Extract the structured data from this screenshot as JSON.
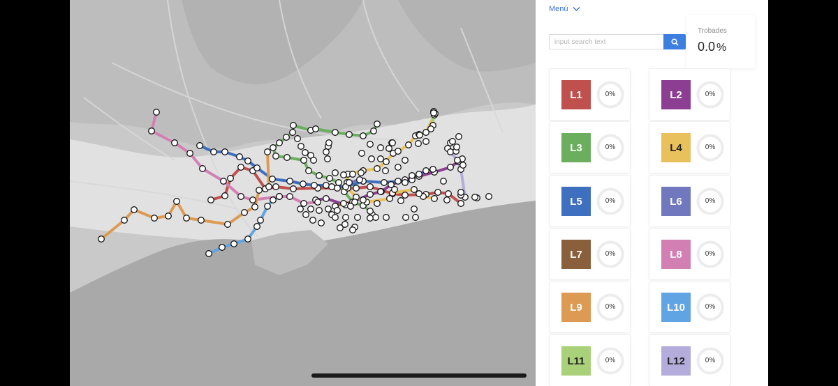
{
  "menu": {
    "label": "Menú"
  },
  "search": {
    "placeholder": "input search text"
  },
  "stats": {
    "label": "Trobades",
    "value": "0.0",
    "unit": "%"
  },
  "lines": [
    {
      "code": "L1",
      "percent": "0%",
      "color": "#c0504d",
      "text_color": "#ffffff"
    },
    {
      "code": "L2",
      "percent": "0%",
      "color": "#8c3f92",
      "text_color": "#ffffff"
    },
    {
      "code": "L3",
      "percent": "0%",
      "color": "#6aae5e",
      "text_color": "#ffffff"
    },
    {
      "code": "L4",
      "percent": "0%",
      "color": "#e9c15c",
      "text_color": "#222222"
    },
    {
      "code": "L5",
      "percent": "0%",
      "color": "#3f6fbf",
      "text_color": "#ffffff"
    },
    {
      "code": "L6",
      "percent": "0%",
      "color": "#7178bd",
      "text_color": "#ffffff"
    },
    {
      "code": "L7",
      "percent": "0%",
      "color": "#8a5f3c",
      "text_color": "#ffffff"
    },
    {
      "code": "L8",
      "percent": "0%",
      "color": "#d27fb4",
      "text_color": "#ffffff"
    },
    {
      "code": "L9",
      "percent": "0%",
      "color": "#dc9a52",
      "text_color": "#ffffff"
    },
    {
      "code": "L10",
      "percent": "0%",
      "color": "#60a4e4",
      "text_color": "#ffffff"
    },
    {
      "code": "L11",
      "percent": "0%",
      "color": "#a9d17a",
      "text_color": "#222222"
    },
    {
      "code": "L12",
      "percent": "0%",
      "color": "#b4addb",
      "text_color": "#222222"
    }
  ]
}
